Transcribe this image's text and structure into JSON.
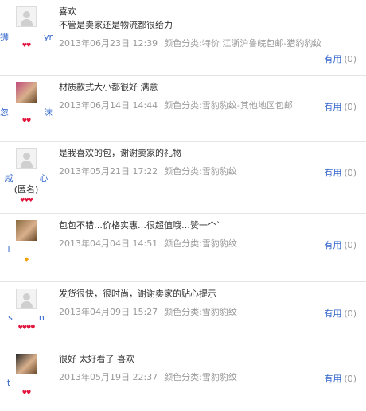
{
  "reviews": [
    {
      "nickname": "狮    ym",
      "avatar_type": "default",
      "level": "♥♥",
      "content": [
        "喜欢",
        "不管是卖家还是物流都很给力"
      ],
      "date": "2013年06月23日 12:39",
      "spec": "颜色分类:特价 江浙沪鲁皖包邮-猎豹豹纹",
      "useful_label": "有用",
      "useful_count": "(0)"
    },
    {
      "nickname": "忽    沫",
      "avatar_type": "photo",
      "level": "♥♥",
      "content": [
        "材质款式大小都很好 满意"
      ],
      "date": "2013年06月14日 14:44",
      "spec": "颜色分类:雪豹豹纹-其他地区包邮",
      "useful_label": "有用",
      "useful_count": "(0)"
    },
    {
      "nickname": "咸   心",
      "anonymous": "(匿名)",
      "avatar_type": "default",
      "level": "♥♥♥",
      "content": [
        "是我喜欢的包，谢谢卖家的礼物"
      ],
      "date": "2013年05月21日 17:22",
      "spec": "颜色分类:雪豹豹纹",
      "useful_label": "有用",
      "useful_count": "(0)"
    },
    {
      "nickname": "l    ",
      "avatar_type": "photo",
      "level": "◆",
      "level_gold": true,
      "content": [
        "包包不错…价格实惠…很超值哦…赞一个`"
      ],
      "date": "2013年04月04日 14:51",
      "spec": "颜色分类:雪豹豹纹",
      "useful_label": "有用",
      "useful_count": "(0)"
    },
    {
      "nickname": "s   n",
      "avatar_type": "default",
      "level": "♥♥♥♥",
      "content": [
        "发货很快，很时尚，谢谢卖家的贴心提示"
      ],
      "date": "2013年04月09日 15:27",
      "spec": "颜色分类:雪豹豹纹",
      "useful_label": "有用",
      "useful_count": "(0)"
    },
    {
      "nickname": "t    ",
      "avatar_type": "photo",
      "level": "♥♥",
      "content": [
        "很好 太好看了 喜欢"
      ],
      "date": "2013年05月19日 22:37",
      "spec": "颜色分类:雪豹豹纹",
      "useful_label": "有用",
      "useful_count": "(0)"
    }
  ]
}
